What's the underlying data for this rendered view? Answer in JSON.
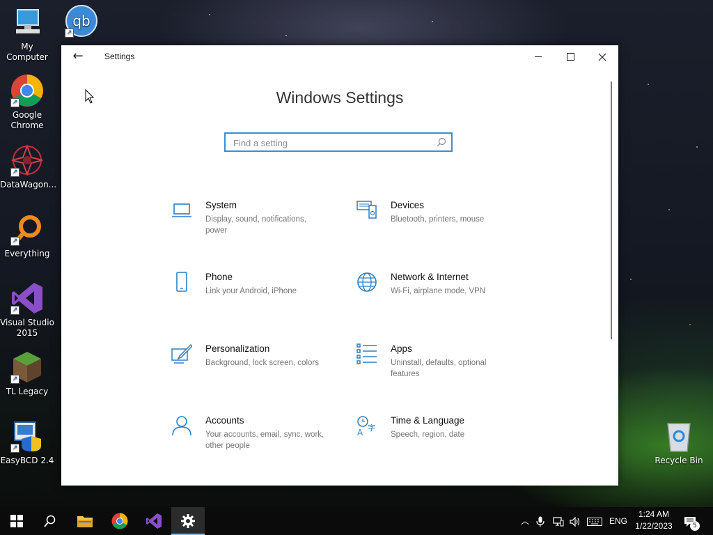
{
  "desktop": {
    "icons": [
      {
        "label": "My Computer"
      },
      {
        "label": "qBittorrent"
      },
      {
        "label": "Google Chrome"
      },
      {
        "label": "DataWagon..."
      },
      {
        "label": "Everything"
      },
      {
        "label": "Visual Studio 2015"
      },
      {
        "label": "TL Legacy"
      },
      {
        "label": "EasyBCD 2.4"
      },
      {
        "label": "Recycle Bin"
      }
    ],
    "qb_logo_text": "qb"
  },
  "window": {
    "title": "Settings",
    "heading": "Windows Settings",
    "search": {
      "placeholder": "Find a setting",
      "value": ""
    },
    "tiles": [
      {
        "name": "System",
        "desc": "Display, sound, notifications, power",
        "icon": "laptop-icon"
      },
      {
        "name": "Devices",
        "desc": "Bluetooth, printers, mouse",
        "icon": "devices-icon"
      },
      {
        "name": "Phone",
        "desc": "Link your Android, iPhone",
        "icon": "phone-icon"
      },
      {
        "name": "Network & Internet",
        "desc": "Wi-Fi, airplane mode, VPN",
        "icon": "globe-icon"
      },
      {
        "name": "Personalization",
        "desc": "Background, lock screen, colors",
        "icon": "paintbrush-icon"
      },
      {
        "name": "Apps",
        "desc": "Uninstall, defaults, optional features",
        "icon": "apps-list-icon"
      },
      {
        "name": "Accounts",
        "desc": "Your accounts, email, sync, work, other people",
        "icon": "person-icon"
      },
      {
        "name": "Time & Language",
        "desc": "Speech, region, date",
        "icon": "time-language-icon"
      }
    ],
    "accent": "#3a8ed6"
  },
  "taskbar": {
    "language": "ENG",
    "time": "1:24 AM",
    "date": "1/22/2023",
    "notifications_count": "5"
  }
}
